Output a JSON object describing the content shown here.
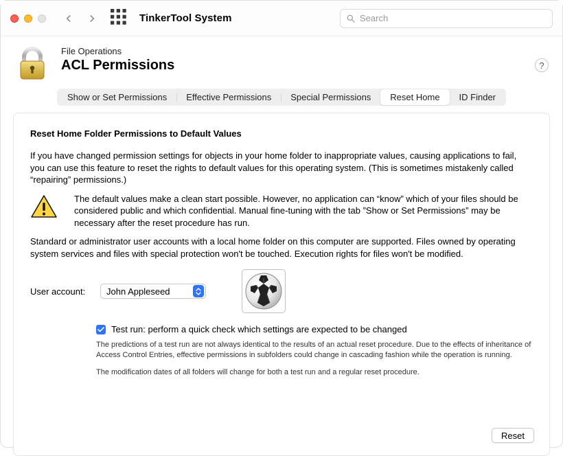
{
  "titlebar": {
    "app_title": "TinkerTool System",
    "search_placeholder": "Search"
  },
  "header": {
    "breadcrumb": "File Operations",
    "page_title": "ACL Permissions",
    "help_label": "?"
  },
  "tabs": [
    {
      "label": "Show or Set Permissions"
    },
    {
      "label": "Effective Permissions"
    },
    {
      "label": "Special Permissions"
    },
    {
      "label": "Reset Home",
      "active": true
    },
    {
      "label": "ID Finder"
    }
  ],
  "card": {
    "section_title": "Reset Home Folder Permissions to Default Values",
    "intro_para": "If you have changed permission settings for objects in your home folder to inappropriate values, causing applications to fail, you can use this feature to reset the rights to default values for this operating system. (This is sometimes mistakenly called “repairing” permissions.)",
    "warn_para": "The default values make a clean start possible. However, no application can “know” which of your files should be considered public and which confidential. Manual fine-tuning with the tab ”Show or Set Permissions” may be necessary after the reset procedure has run.",
    "support_para": "Standard or administrator user accounts with a local home folder on this computer are supported. Files owned by operating system services and files with special protection won't be touched. Execution rights for files won't be modified.",
    "account_label": "User account:",
    "account_value": "John Appleseed",
    "test_run_label": "Test run: perform a quick check which settings are expected to be changed",
    "note1": "The predictions of a test run are not always identical to the results of an actual reset procedure. Due to the effects of inheritance of Access Control Entries, effective permissions in subfolders could change in cascading fashion while the operation is running.",
    "note2": "The modification dates of all folders will change for both a test run and a regular reset procedure.",
    "reset_button": "Reset"
  }
}
